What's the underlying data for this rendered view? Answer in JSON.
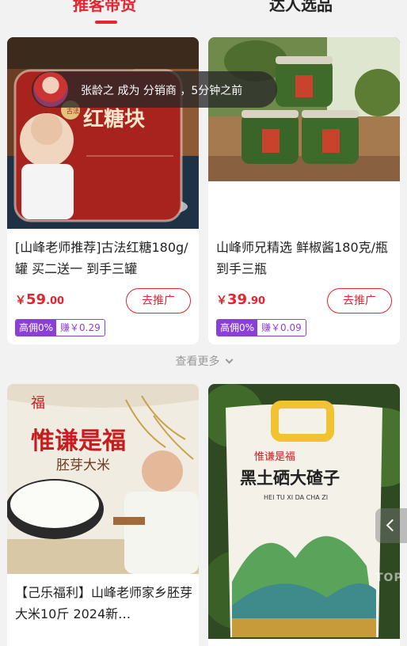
{
  "tabs": [
    {
      "label": "推客带货",
      "active": true
    },
    {
      "label": "达人选品",
      "active": false
    }
  ],
  "toast": {
    "text": "张龄之 成为 分销商 ，5分钟之前"
  },
  "products": [
    {
      "title": "[山峰老师推荐]古法红糖180g/罐 买二送一 到手三罐",
      "image_text": [
        "古法",
        "红糖块"
      ],
      "price_symbol": "￥",
      "price_int": "59",
      "price_dec": ".00",
      "promote_label": "去推广",
      "commission_rate": "高佣0%",
      "commission_earn": "赚￥0.29"
    },
    {
      "title": "山峰师兄精选 鲜椒酱180克/瓶 到手三瓶",
      "image_text": [],
      "price_symbol": "￥",
      "price_int": "39",
      "price_dec": ".90",
      "promote_label": "去推广",
      "commission_rate": "高佣0%",
      "commission_earn": "赚￥0.09"
    },
    {
      "title": "【己乐福利】山峰老师家乡胚芽大米10斤 2024新…",
      "image_text": [
        "惟谦是福",
        "胚芽大米"
      ]
    },
    {
      "title": "",
      "image_text": [
        "惟谦是福",
        "黑土硒大碴子",
        "HEI TU XI DA CHA ZI"
      ]
    }
  ],
  "see_more": {
    "label": "查看更多"
  },
  "side_watermark": "TOP",
  "colors": {
    "accent": "#e8232f",
    "commission": "#8b3fd9"
  }
}
